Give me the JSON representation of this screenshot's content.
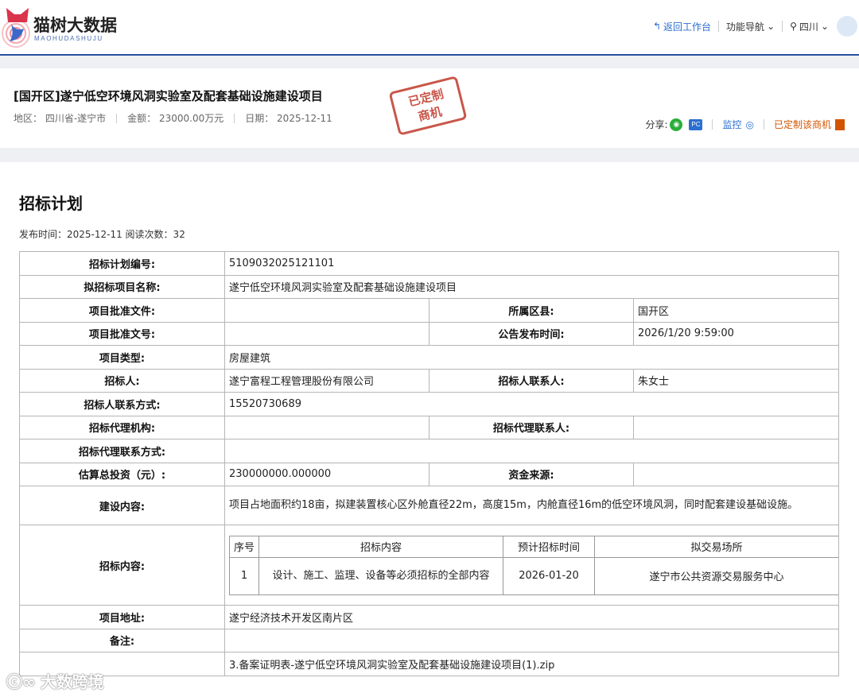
{
  "header": {
    "logo_text": "猫树大数据",
    "logo_sub": "MAOHUDASHUJU",
    "back_label": "返回工作台",
    "func_nav_label": "功能导航",
    "region_label": "四川"
  },
  "project": {
    "title": "[国开区]遂宁低空环境风洞实验室及配套基础设施建设项目",
    "region": "地区： 四川省-遂宁市",
    "amount": "金额： 23000.00万元",
    "date": "日期： 2025-12-11",
    "stamp_line1": "已定制",
    "stamp_line2": "商机",
    "share_label": "分享:",
    "pc_label": "PC",
    "monitor_label": "监控",
    "custom_label": "已定制该商机"
  },
  "section": {
    "title": "招标计划",
    "publish_info": "发布时间：2025-12-11 阅读次数：32"
  },
  "table": {
    "plan_no_label": "招标计划编号:",
    "plan_no": "5109032025121101",
    "project_name_label": "拟招标项目名称:",
    "project_name": "遂宁低空环境风洞实验室及配套基础设施建设项目",
    "approval_file_label": "项目批准文件:",
    "approval_file": "",
    "county_label": "所属区县:",
    "county": "国开区",
    "approval_no_label": "项目批准文号:",
    "approval_no": "",
    "notice_time_label": "公告发布时间:",
    "notice_time": "2026/1/20 9:59:00",
    "type_label": "项目类型:",
    "type": "房屋建筑",
    "tenderer_label": "招标人:",
    "tenderer": "遂宁富程工程管理股份有限公司",
    "tenderer_contact_label": "招标人联系人:",
    "tenderer_contact": "朱女士",
    "tenderer_phone_label": "招标人联系方式:",
    "tenderer_phone": "15520730689",
    "agency_label": "招标代理机构:",
    "agency": "",
    "agency_contact_label": "招标代理联系人:",
    "agency_contact": "",
    "agency_phone_label": "招标代理联系方式:",
    "agency_phone": "",
    "investment_label": "估算总投资（元）:",
    "investment": "230000000.000000",
    "fund_source_label": "资金来源:",
    "fund_source": "",
    "construction_label": "建设内容:",
    "construction": "项目占地面积约18亩，拟建装置核心区外舱直径22m，高度15m，内舱直径16m的低空环境风洞，同时配套建设基础设施。",
    "tender_content_label": "招标内容:",
    "inner_headers": [
      "序号",
      "招标内容",
      "预计招标时间",
      "拟交易场所"
    ],
    "inner_rows": [
      {
        "no": "1",
        "content": "设计、施工、监理、设备等必须招标的全部内容",
        "time": "2026-01-20",
        "place": "遂宁市公共资源交易服务中心"
      }
    ],
    "address_label": "项目地址:",
    "address": "遂宁经济技术开发区南片区",
    "remark_label": "备注:",
    "remark": "",
    "attachment": "3.备案证明表-遂宁低空环境风洞实验室及配套基础设施建设项目(1).zip"
  },
  "watermark": "大数跨境"
}
